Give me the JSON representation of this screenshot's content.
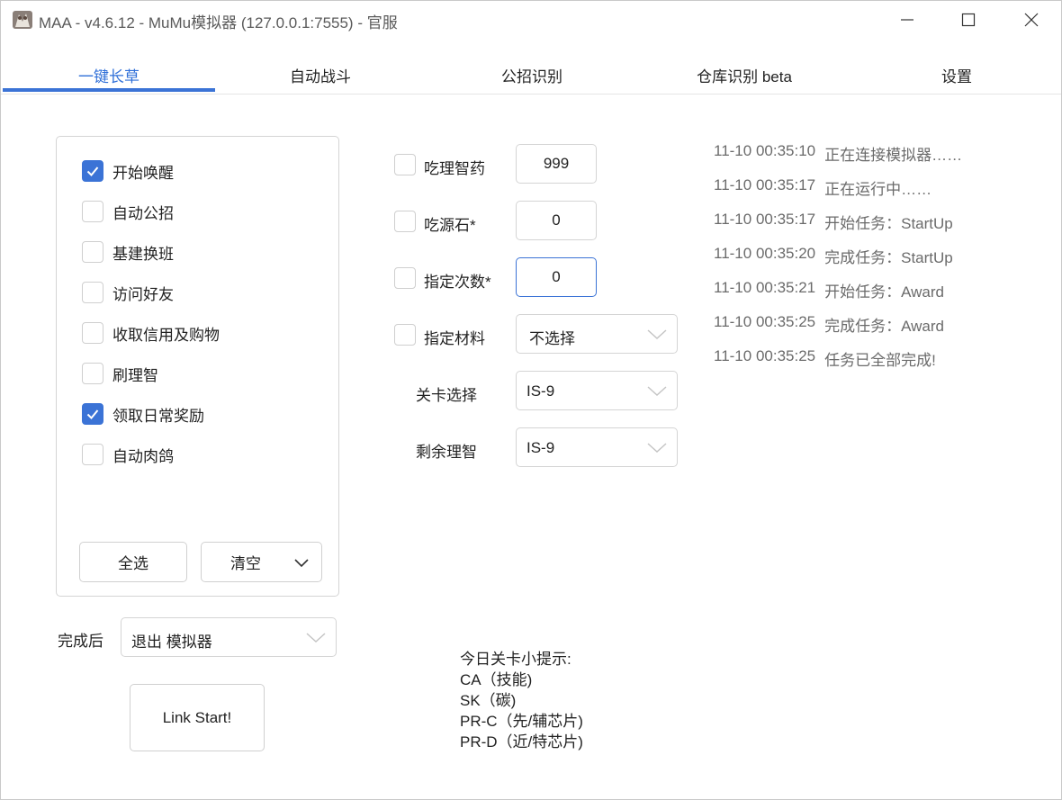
{
  "window": {
    "title": "MAA - v4.6.12 - MuMu模拟器 (127.0.0.1:7555) - 官服"
  },
  "tabs": [
    {
      "label": "一键长草",
      "active": true
    },
    {
      "label": "自动战斗",
      "active": false
    },
    {
      "label": "公招识别",
      "active": false
    },
    {
      "label": "仓库识别 beta",
      "active": false
    },
    {
      "label": "设置",
      "active": false
    }
  ],
  "tasks": [
    {
      "label": "开始唤醒",
      "checked": true
    },
    {
      "label": "自动公招",
      "checked": false
    },
    {
      "label": "基建换班",
      "checked": false
    },
    {
      "label": "访问好友",
      "checked": false
    },
    {
      "label": "收取信用及购物",
      "checked": false
    },
    {
      "label": "刷理智",
      "checked": false
    },
    {
      "label": "领取日常奖励",
      "checked": true
    },
    {
      "label": "自动肉鸽",
      "checked": false
    }
  ],
  "task_buttons": {
    "select_all": "全选",
    "clear": "清空"
  },
  "after_completion": {
    "label": "完成后",
    "value": "退出 模拟器"
  },
  "start_button": "Link Start!",
  "options": {
    "medicine": {
      "label": "吃理智药",
      "value": "999",
      "checked": false
    },
    "stone": {
      "label": "吃源石*",
      "value": "0",
      "checked": false
    },
    "times": {
      "label": "指定次数*",
      "value": "0",
      "checked": false
    },
    "material": {
      "label": "指定材料",
      "value": "不选择",
      "checked": false
    },
    "stage": {
      "label": "关卡选择",
      "value": "IS-9"
    },
    "remaining": {
      "label": "剩余理智",
      "value": "IS-9"
    }
  },
  "log": [
    {
      "time": "11-10  00:35:10",
      "message": "正在连接模拟器……"
    },
    {
      "time": "11-10  00:35:17",
      "message": "正在运行中……"
    },
    {
      "time": "11-10  00:35:17",
      "message": "开始任务：StartUp"
    },
    {
      "time": "11-10  00:35:20",
      "message": "完成任务：StartUp"
    },
    {
      "time": "11-10  00:35:21",
      "message": "开始任务：Award"
    },
    {
      "time": "11-10  00:35:25",
      "message": "完成任务：Award"
    },
    {
      "time": "11-10  00:35:25",
      "message": "任务已全部完成!"
    }
  ],
  "tips": {
    "heading": "今日关卡小提示:",
    "items": [
      "CA（技能)",
      "SK（碳)",
      "PR-C（先/辅芯片)",
      "PR-D（近/特芯片)"
    ]
  },
  "colors": {
    "accent": "#3b73d6",
    "log_text": "#6b6b6b"
  }
}
